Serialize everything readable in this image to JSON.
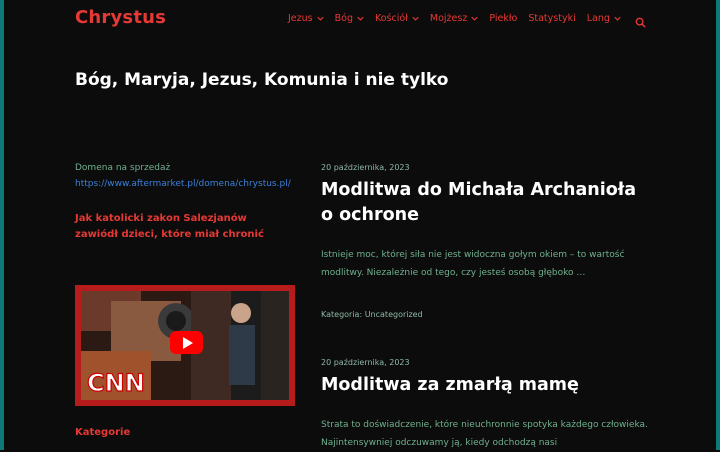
{
  "header": {
    "logo": "Chrystus",
    "nav": [
      {
        "label": "Jezus",
        "has_dropdown": true
      },
      {
        "label": "Bóg",
        "has_dropdown": true
      },
      {
        "label": "Kościół",
        "has_dropdown": true
      },
      {
        "label": "Mojżesz",
        "has_dropdown": true
      },
      {
        "label": "Piekło",
        "has_dropdown": false
      },
      {
        "label": "Statystyki",
        "has_dropdown": false
      },
      {
        "label": "Lang",
        "has_dropdown": true
      }
    ],
    "search_icon": "search-icon"
  },
  "site_title": "Bóg, Maryja, Jezus, Komunia i nie tylko",
  "sidebar": {
    "domain_text": "Domena na sprzedaż",
    "domain_link": "https://www.aftermarket.pl/domena/chrystus.pl/",
    "article_link": "Jak katolicki zakon Salezjanów zawiódł dzieci, które miał chronić",
    "video_logo": "CNN",
    "categories_heading": "Kategorie"
  },
  "posts": [
    {
      "date": "20 października, 2023",
      "title": "Modlitwa do Michała Archanioła o ochrone",
      "excerpt": "Istnieje moc, której siła nie jest widoczna gołym okiem – to wartość modlitwy. Niezależnie od tego, czy jesteś osobą głęboko …",
      "category_label": "Kategoria: ",
      "category": "Uncategorized"
    },
    {
      "date": "20 października, 2023",
      "title": "Modlitwa za zmarłą mamę",
      "excerpt": "Strata to doświadczenie, które nieuchronnie spotyka każdego człowieka. Najintensywniej odczuwamy ją, kiedy odchodzą nasi"
    }
  ],
  "colors": {
    "accent": "#e53935",
    "background": "#0c0c0c",
    "frame": "#0e7a78",
    "excerpt": "#6fb08f",
    "link": "#3a80d9"
  }
}
